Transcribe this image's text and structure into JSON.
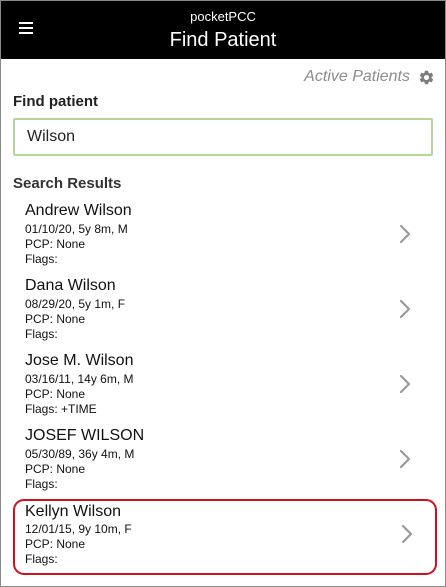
{
  "header": {
    "app_name": "pocketPCC",
    "title": "Find Patient",
    "menu_icon": "hamburger-menu-icon"
  },
  "toolbar": {
    "active_patients_label": "Active Patients",
    "settings_icon": "gear-icon"
  },
  "search": {
    "label": "Find patient",
    "value": "Wilson",
    "border_color": "#b6d59b"
  },
  "results": {
    "label": "Search Results",
    "chevron_icon": "chevron-right-icon",
    "selected_outline_color": "#d0121b",
    "items": [
      {
        "name": "Andrew Wilson",
        "dob": "01/10/20, 5y 8m, M",
        "pcp": "PCP: None",
        "flags": "Flags:"
      },
      {
        "name": "Dana Wilson",
        "dob": "08/29/20, 5y 1m, F",
        "pcp": "PCP: None",
        "flags": "Flags:"
      },
      {
        "name": "Jose M. Wilson",
        "dob": "03/16/11, 14y 6m, M",
        "pcp": "PCP: None",
        "flags": "Flags: +TIME"
      },
      {
        "name": "JOSEF WILSON",
        "dob": "05/30/89, 36y 4m, M",
        "pcp": "PCP: None",
        "flags": "Flags:"
      },
      {
        "name": "Kellyn Wilson",
        "dob": "12/01/15, 9y 10m, F",
        "pcp": "PCP: None",
        "flags": "Flags:",
        "selected": true
      }
    ]
  }
}
